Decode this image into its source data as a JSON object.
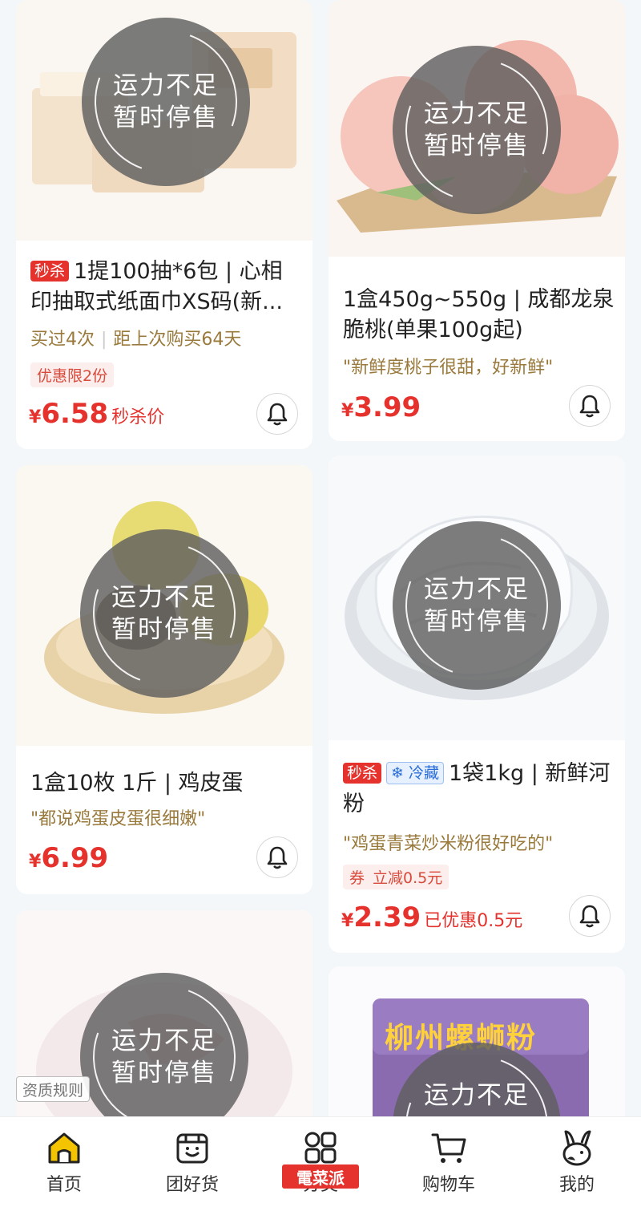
{
  "overlay": {
    "line1": "运力不足",
    "line2": "暂时停售"
  },
  "products": [
    {
      "tag": "秒杀",
      "title": "1提100抽*6包 | 心相印抽取式纸面巾XS码(新...",
      "bought": "买过4次",
      "last_buy": "距上次购买64天",
      "limit": "优惠限2份",
      "price_symbol": "¥",
      "price": "6.58",
      "price_suffix": "秒杀价"
    },
    {
      "title": "1盒450g~550g | 成都龙泉脆桃(单果100g起)",
      "quote": "\"新鲜度桃子很甜，好新鲜\"",
      "price_symbol": "¥",
      "price": "3.99"
    },
    {
      "title": "1盒10枚 1斤 | 鸡皮蛋",
      "quote": "\"都说鸡蛋皮蛋很细嫩\"",
      "price_symbol": "¥",
      "price": "6.99"
    },
    {
      "tag": "秒杀",
      "tag2": "冷藏",
      "title": "1袋1kg | 新鲜河粉",
      "quote": "\"鸡蛋青菜炒米粉很好吃的\"",
      "coupon_label": "券",
      "coupon_text": "立减0.5元",
      "price_symbol": "¥",
      "price": "2.39",
      "price_suffix": "已优惠0.5元"
    },
    {
      "package_text": "柳州螺蛳粉"
    }
  ],
  "qualification": "资质规则",
  "nav": [
    {
      "label": "首页",
      "icon": "home-icon"
    },
    {
      "label": "团好货",
      "icon": "bag-smile-icon"
    },
    {
      "label": "分类",
      "icon": "grid-icon"
    },
    {
      "label": "购物车",
      "icon": "cart-icon"
    },
    {
      "label": "我的",
      "icon": "rabbit-icon"
    }
  ],
  "watermark": "電菜派",
  "colors": {
    "accent_red": "#e5322d",
    "nav_active": "#f5c400",
    "quote_brown": "#9a7a3c"
  }
}
